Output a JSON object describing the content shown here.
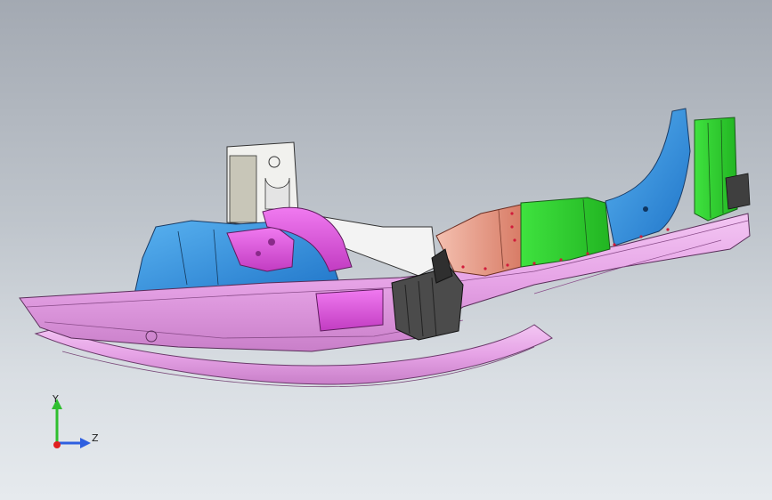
{
  "viewport": {
    "background_top": "#a3a9b2",
    "background_bottom": "#e6eaee"
  },
  "model": {
    "colors": {
      "pink_sill": "#e8a4e8",
      "magenta": "#d94fd9",
      "blue": "#2e90e0",
      "green": "#33d633",
      "salmon": "#e59a88",
      "white": "#f2f2f2",
      "dark": "#3a3a3a",
      "red_dots": "#d11b3b"
    }
  },
  "triad": {
    "y_label": "Y",
    "z_label": "Z",
    "y_color": "#2fbf2f",
    "z_color": "#2e5fe0",
    "x_color": "#e02020"
  }
}
